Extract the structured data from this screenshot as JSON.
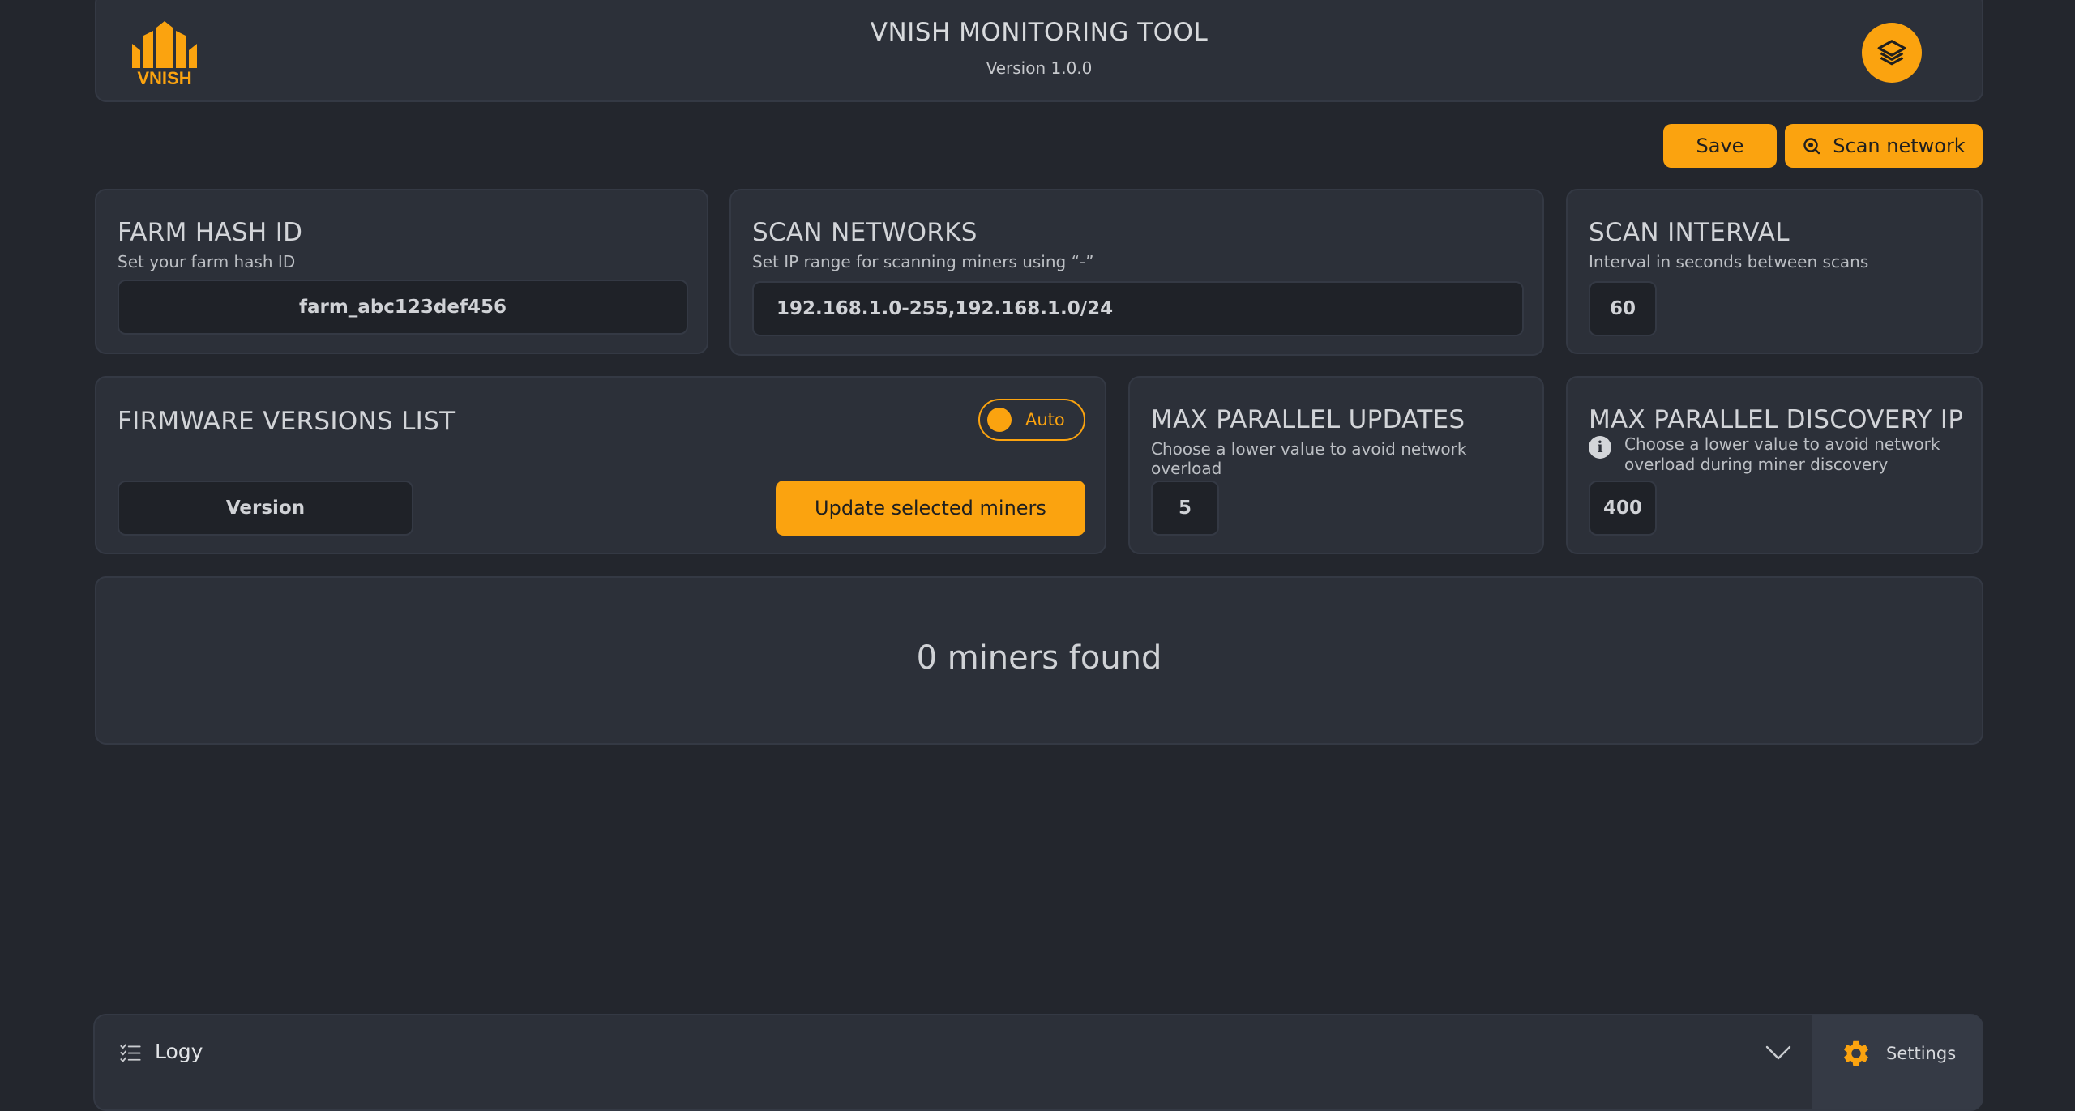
{
  "header": {
    "logo_text": "VNISH",
    "title": "VNISH MONITORING TOOL",
    "version": "Version 1.0.0",
    "layers_icon": "layers-icon"
  },
  "toolbar": {
    "save_label": "Save",
    "scan_label": "Scan network"
  },
  "farm": {
    "title": "FARM HASH ID",
    "subtitle": "Set your farm hash ID",
    "value": "farm_abc123def456"
  },
  "scan_networks": {
    "title": "SCAN NETWORKS",
    "subtitle": "Set IP range for scanning miners using “-”",
    "value": "192.168.1.0-255,192.168.1.0/24"
  },
  "scan_interval": {
    "title": "SCAN INTERVAL",
    "subtitle": "Interval in seconds between scans",
    "value": "60"
  },
  "firmware": {
    "title": "FIRMWARE VERSIONS LIST",
    "toggle_label": "Auto",
    "version_placeholder": "Version",
    "update_label": "Update selected miners"
  },
  "parallel_updates": {
    "title": "MAX PARALLEL UPDATES",
    "subtitle": "Choose a lower value to avoid network overload",
    "value": "5"
  },
  "parallel_discovery": {
    "title": "MAX PARALLEL DISCOVERY IP",
    "subtitle": "Choose a lower value to avoid network overload during miner discovery",
    "value": "400"
  },
  "miners": {
    "status": "0 miners found"
  },
  "bottom": {
    "log_label": "Logy",
    "settings_label": "Settings"
  },
  "colors": {
    "accent": "#fba30f",
    "background": "#23262d",
    "panel": "#2c3039"
  }
}
